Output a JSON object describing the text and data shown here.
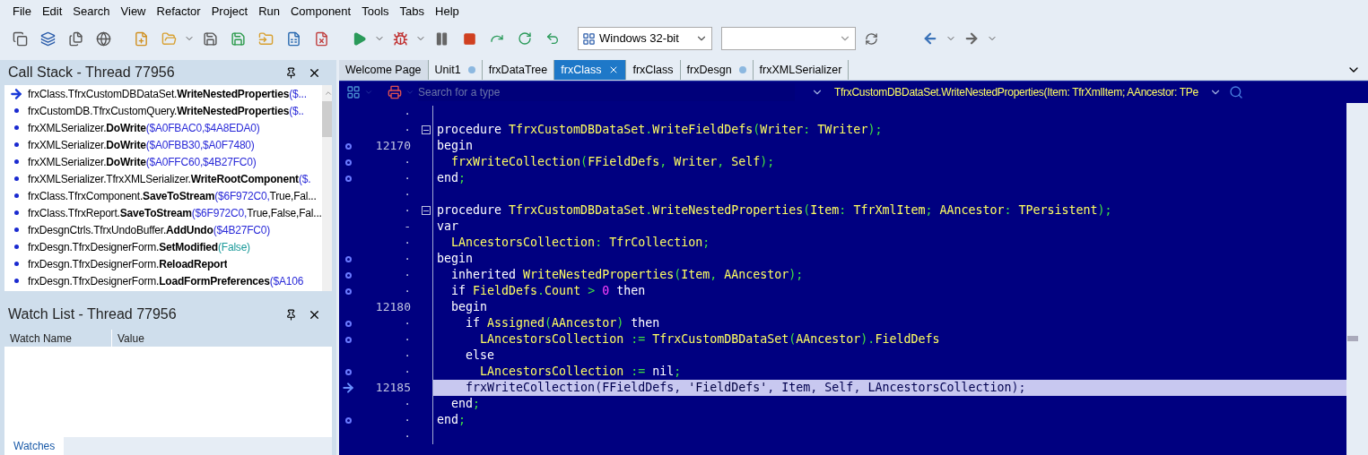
{
  "menu": [
    "File",
    "Edit",
    "Search",
    "View",
    "Refactor",
    "Project",
    "Run",
    "Component",
    "Tools",
    "Tabs",
    "Help"
  ],
  "toolbar": {
    "platform": "Windows 32-bit"
  },
  "call_stack": {
    "title": "Call Stack - Thread 77956",
    "frames": [
      {
        "current": true,
        "parts": [
          {
            "kind": "plain",
            "t": "frxClass.TfrxCustomDBDataSet."
          },
          {
            "kind": "bold",
            "t": "WriteNestedProperties"
          },
          {
            "kind": "addr",
            "t": "($..."
          }
        ]
      },
      {
        "current": false,
        "parts": [
          {
            "kind": "plain",
            "t": "frxCustomDB.TfrxCustomQuery."
          },
          {
            "kind": "bold",
            "t": "WriteNestedProperties"
          },
          {
            "kind": "addr",
            "t": "($.."
          }
        ]
      },
      {
        "current": false,
        "parts": [
          {
            "kind": "plain",
            "t": "frxXMLSerializer."
          },
          {
            "kind": "bold",
            "t": "DoWrite"
          },
          {
            "kind": "addr",
            "t": "($A0FBAC0,$4A8EDA0)"
          }
        ]
      },
      {
        "current": false,
        "parts": [
          {
            "kind": "plain",
            "t": "frxXMLSerializer."
          },
          {
            "kind": "bold",
            "t": "DoWrite"
          },
          {
            "kind": "addr",
            "t": "($A0FBB30,$A0F7480)"
          }
        ]
      },
      {
        "current": false,
        "parts": [
          {
            "kind": "plain",
            "t": "frxXMLSerializer."
          },
          {
            "kind": "bold",
            "t": "DoWrite"
          },
          {
            "kind": "addr",
            "t": "($A0FFC60,$4B27FC0)"
          }
        ]
      },
      {
        "current": false,
        "parts": [
          {
            "kind": "plain",
            "t": "frxXMLSerializer.TfrxXMLSerializer."
          },
          {
            "kind": "bold",
            "t": "WriteRootComponent"
          },
          {
            "kind": "addr",
            "t": "($."
          }
        ]
      },
      {
        "current": false,
        "parts": [
          {
            "kind": "plain",
            "t": "frxClass.TfrxComponent."
          },
          {
            "kind": "bold",
            "t": "SaveToStream"
          },
          {
            "kind": "addr",
            "t": "($6F972C0,"
          },
          {
            "kind": "plain",
            "t": "True,Fal..."
          }
        ]
      },
      {
        "current": false,
        "parts": [
          {
            "kind": "plain",
            "t": "frxClass.TfrxReport."
          },
          {
            "kind": "bold",
            "t": "SaveToStream"
          },
          {
            "kind": "addr",
            "t": "($6F972C0,"
          },
          {
            "kind": "plain",
            "t": "True,False,Fal..."
          }
        ]
      },
      {
        "current": false,
        "parts": [
          {
            "kind": "plain",
            "t": "frxDesgnCtrls.TfrxUndoBuffer."
          },
          {
            "kind": "bold",
            "t": "AddUndo"
          },
          {
            "kind": "addr",
            "t": "($4B27FC0)"
          }
        ]
      },
      {
        "current": false,
        "parts": [
          {
            "kind": "plain",
            "t": "frxDesgn.TfrxDesignerForm."
          },
          {
            "kind": "bold",
            "t": "SetModified"
          },
          {
            "kind": "bool",
            "t": "(False)"
          }
        ]
      },
      {
        "current": false,
        "parts": [
          {
            "kind": "plain",
            "t": "frxDesgn.TfrxDesignerForm."
          },
          {
            "kind": "bold",
            "t": "ReloadReport"
          }
        ]
      },
      {
        "current": false,
        "parts": [
          {
            "kind": "plain",
            "t": "frxDesgn.TfrxDesignerForm."
          },
          {
            "kind": "bold",
            "t": "LoadFormPreferences"
          },
          {
            "kind": "addr",
            "t": "($A106"
          }
        ]
      }
    ]
  },
  "watch_list": {
    "title": "Watch List - Thread 77956",
    "columns": [
      "Watch Name",
      "Value"
    ],
    "tabs": [
      {
        "label": "Watches",
        "selected": true
      }
    ]
  },
  "editor_tabs": [
    {
      "label": "Welcome Page",
      "selected": false,
      "modified": false,
      "closable": false
    },
    {
      "label": "Unit1",
      "selected": false,
      "modified": true,
      "closable": false
    },
    {
      "label": "frxDataTree",
      "selected": false,
      "modified": false,
      "closable": false
    },
    {
      "label": "frxClass",
      "selected": true,
      "modified": false,
      "closable": true
    },
    {
      "label": "frxClass",
      "selected": false,
      "modified": false,
      "closable": false
    },
    {
      "label": "frxDesgn",
      "selected": false,
      "modified": true,
      "closable": false
    },
    {
      "label": "frxXMLSerializer",
      "selected": false,
      "modified": false,
      "closable": false
    }
  ],
  "editor_bar": {
    "type_search_placeholder": "Search for a type",
    "method": "TfrxCustomDBDataSet.WriteNestedProperties(Item: TfrXmlItem; AAncestor: TPe"
  },
  "code": [
    {
      "gutter": "·",
      "breakpoint": false,
      "fold": false,
      "current": false
    },
    {
      "gutter": "·",
      "breakpoint": false,
      "fold": true,
      "current": false,
      "tokens": [
        {
          "kind": "kw",
          "t": "procedure "
        },
        {
          "kind": "id",
          "t": "TfrxCustomDBDataSet"
        },
        {
          "kind": "sym",
          "t": "."
        },
        {
          "kind": "id",
          "t": "WriteFieldDefs"
        },
        {
          "kind": "sym",
          "t": "("
        },
        {
          "kind": "id",
          "t": "Writer"
        },
        {
          "kind": "sym",
          "t": ": "
        },
        {
          "kind": "id",
          "t": "TWriter"
        },
        {
          "kind": "sym",
          "t": ");"
        }
      ]
    },
    {
      "gutter": "12170",
      "breakpoint": true,
      "fold": false,
      "current": false,
      "tokens": [
        {
          "kind": "kw",
          "t": "begin"
        }
      ]
    },
    {
      "gutter": "·",
      "breakpoint": true,
      "fold": false,
      "current": false,
      "tokens": [
        {
          "kind": "id",
          "t": "  frxWriteCollection"
        },
        {
          "kind": "sym",
          "t": "("
        },
        {
          "kind": "id",
          "t": "FFieldDefs"
        },
        {
          "kind": "sym",
          "t": ", "
        },
        {
          "kind": "id",
          "t": "Writer"
        },
        {
          "kind": "sym",
          "t": ", "
        },
        {
          "kind": "id",
          "t": "Self"
        },
        {
          "kind": "sym",
          "t": ");"
        }
      ]
    },
    {
      "gutter": "·",
      "breakpoint": true,
      "fold": false,
      "current": false,
      "tokens": [
        {
          "kind": "kw",
          "t": "end"
        },
        {
          "kind": "sym",
          "t": ";"
        }
      ]
    },
    {
      "gutter": "·",
      "breakpoint": false,
      "fold": false,
      "current": false
    },
    {
      "gutter": "·",
      "breakpoint": false,
      "fold": true,
      "current": false,
      "tokens": [
        {
          "kind": "kw",
          "t": "procedure "
        },
        {
          "kind": "id",
          "t": "TfrxCustomDBDataSet"
        },
        {
          "kind": "sym",
          "t": "."
        },
        {
          "kind": "id",
          "t": "WriteNestedProperties"
        },
        {
          "kind": "sym",
          "t": "("
        },
        {
          "kind": "id",
          "t": "Item"
        },
        {
          "kind": "sym",
          "t": ": "
        },
        {
          "kind": "id",
          "t": "TfrXmlItem"
        },
        {
          "kind": "sym",
          "t": "; "
        },
        {
          "kind": "id",
          "t": "AAncestor"
        },
        {
          "kind": "sym",
          "t": ": "
        },
        {
          "kind": "id",
          "t": "TPersistent"
        },
        {
          "kind": "sym",
          "t": ");"
        }
      ]
    },
    {
      "gutter": "-",
      "breakpoint": false,
      "fold": false,
      "current": false,
      "tokens": [
        {
          "kind": "kw",
          "t": "var"
        }
      ]
    },
    {
      "gutter": "·",
      "breakpoint": false,
      "fold": false,
      "current": false,
      "tokens": [
        {
          "kind": "id",
          "t": "  LAncestorsCollection"
        },
        {
          "kind": "sym",
          "t": ": "
        },
        {
          "kind": "id",
          "t": "TfrCollection"
        },
        {
          "kind": "sym",
          "t": ";"
        }
      ]
    },
    {
      "gutter": "·",
      "breakpoint": true,
      "fold": false,
      "current": false,
      "tokens": [
        {
          "kind": "kw",
          "t": "begin"
        }
      ]
    },
    {
      "gutter": "·",
      "breakpoint": true,
      "fold": false,
      "current": false,
      "tokens": [
        {
          "kind": "kw",
          "t": "  inherited "
        },
        {
          "kind": "id",
          "t": "WriteNestedProperties"
        },
        {
          "kind": "sym",
          "t": "("
        },
        {
          "kind": "id",
          "t": "Item"
        },
        {
          "kind": "sym",
          "t": ", "
        },
        {
          "kind": "id",
          "t": "AAncestor"
        },
        {
          "kind": "sym",
          "t": ");"
        }
      ]
    },
    {
      "gutter": "·",
      "breakpoint": true,
      "fold": false,
      "current": false,
      "tokens": [
        {
          "kind": "kw",
          "t": "  if "
        },
        {
          "kind": "id",
          "t": "FieldDefs"
        },
        {
          "kind": "sym",
          "t": "."
        },
        {
          "kind": "id",
          "t": "Count"
        },
        {
          "kind": "sym",
          "t": " > "
        },
        {
          "kind": "num",
          "t": "0"
        },
        {
          "kind": "kw",
          "t": " then"
        }
      ]
    },
    {
      "gutter": "12180",
      "breakpoint": false,
      "fold": false,
      "current": false,
      "tokens": [
        {
          "kind": "kw",
          "t": "  begin"
        }
      ]
    },
    {
      "gutter": "·",
      "breakpoint": true,
      "fold": false,
      "current": false,
      "tokens": [
        {
          "kind": "kw",
          "t": "    if "
        },
        {
          "kind": "id",
          "t": "Assigned"
        },
        {
          "kind": "sym",
          "t": "("
        },
        {
          "kind": "id",
          "t": "AAncestor"
        },
        {
          "kind": "sym",
          "t": ")"
        },
        {
          "kind": "kw",
          "t": " then"
        }
      ]
    },
    {
      "gutter": "·",
      "breakpoint": true,
      "fold": false,
      "current": false,
      "tokens": [
        {
          "kind": "id",
          "t": "      LAncestorsCollection"
        },
        {
          "kind": "sym",
          "t": " := "
        },
        {
          "kind": "id",
          "t": "TfrxCustomDBDataSet"
        },
        {
          "kind": "sym",
          "t": "("
        },
        {
          "kind": "id",
          "t": "AAncestor"
        },
        {
          "kind": "sym",
          "t": ")."
        },
        {
          "kind": "id",
          "t": "FieldDefs"
        }
      ]
    },
    {
      "gutter": "·",
      "breakpoint": false,
      "fold": false,
      "current": false,
      "tokens": [
        {
          "kind": "kw",
          "t": "    else"
        }
      ]
    },
    {
      "gutter": "·",
      "breakpoint": true,
      "fold": false,
      "current": false,
      "tokens": [
        {
          "kind": "id",
          "t": "      LAncestorsCollection"
        },
        {
          "kind": "sym",
          "t": " := "
        },
        {
          "kind": "kw",
          "t": "nil"
        },
        {
          "kind": "sym",
          "t": ";"
        }
      ]
    },
    {
      "gutter": "12185",
      "breakpoint": false,
      "fold": false,
      "current": true,
      "tokens": [
        {
          "kind": "id",
          "t": "    frxWriteCollection"
        },
        {
          "kind": "sym",
          "t": "("
        },
        {
          "kind": "id",
          "t": "FFieldDefs"
        },
        {
          "kind": "sym",
          "t": ", "
        },
        {
          "kind": "str",
          "t": "'FieldDefs'"
        },
        {
          "kind": "sym",
          "t": ", "
        },
        {
          "kind": "id",
          "t": "Item"
        },
        {
          "kind": "sym",
          "t": ", "
        },
        {
          "kind": "id",
          "t": "Self"
        },
        {
          "kind": "sym",
          "t": ", "
        },
        {
          "kind": "id",
          "t": "LAncestorsCollection"
        },
        {
          "kind": "sym",
          "t": ");"
        }
      ]
    },
    {
      "gutter": "·",
      "breakpoint": false,
      "fold": false,
      "current": false,
      "tokens": [
        {
          "kind": "kw",
          "t": "  end"
        },
        {
          "kind": "sym",
          "t": ";"
        }
      ]
    },
    {
      "gutter": "·",
      "breakpoint": true,
      "fold": false,
      "current": false,
      "tokens": [
        {
          "kind": "kw",
          "t": "end"
        },
        {
          "kind": "sym",
          "t": ";"
        }
      ]
    },
    {
      "gutter": "·",
      "breakpoint": false,
      "fold": false,
      "current": false
    }
  ]
}
